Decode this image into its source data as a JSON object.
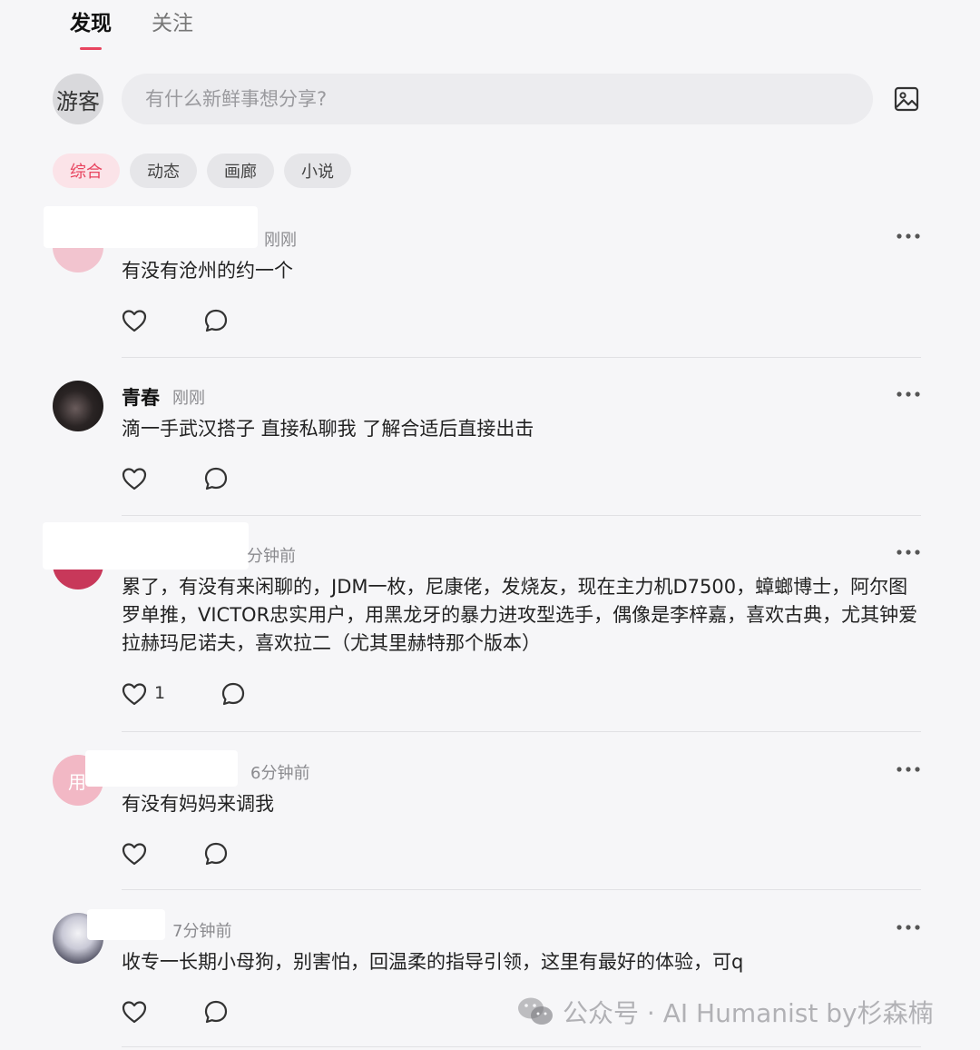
{
  "nav": {
    "tab_active": "发现",
    "tab_inactive": "关注"
  },
  "composer": {
    "avatar_text": "游客",
    "placeholder": "有什么新鲜事想分享?"
  },
  "filters": [
    "综合",
    "动态",
    "画廊",
    "小说"
  ],
  "posts": [
    {
      "username": "",
      "time": "刚刚",
      "text": "有没有沧州的约一个",
      "likes": ""
    },
    {
      "username": "青春",
      "time": "刚刚",
      "text": "滴一手武汉搭子 直接私聊我 了解合适后直接出击",
      "likes": ""
    },
    {
      "username": "",
      "time": "分钟前",
      "text": "累了，有没有来闲聊的，JDM一枚，尼康佬，发烧友，现在主力机D7500，蟑螂博士，阿尔图罗单推，VICTOR忠实用户，用黑龙牙的暴力进攻型选手，偶像是李梓嘉，喜欢古典，尤其钟爱拉赫玛尼诺夫，喜欢拉二（尤其里赫特那个版本）",
      "likes": "1"
    },
    {
      "username": "",
      "avatar_text": "用",
      "time": "6分钟前",
      "text": "有没有妈妈来调我",
      "likes": ""
    },
    {
      "username": "",
      "time": "7分钟前",
      "text": "收专一长期小母狗，别害怕，回温柔的指导引领，这里有最好的体验，可q",
      "likes": ""
    }
  ],
  "watermark": "公众号 · AI Humanist by杉森楠",
  "colors": {
    "accent": "#e8445f",
    "background": "#f6f6f8",
    "chip": "#e6e6e9"
  }
}
